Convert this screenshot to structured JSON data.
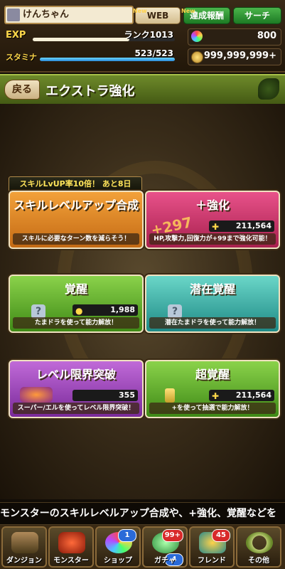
{
  "header": {
    "player_name": "けんちゃん",
    "web_label": "WEB",
    "report_label": "達成報酬",
    "search_label": "サーチ",
    "new_tag": "New",
    "exp_label": "EXP",
    "rank_text": "ランク1013",
    "exp_progress": 0.68,
    "stamina_label": "スタミナ",
    "stamina_text": "523/523",
    "stamina_progress": 1.0,
    "magic_stones": "800",
    "coins": "999,999,999+"
  },
  "titlebar": {
    "back_label": "戻る",
    "title": "エクストラ強化"
  },
  "cards": {
    "skill_banner": "スキルLvUP率10倍！ あと8日",
    "skill": {
      "title": "スキルレベルアップ合成",
      "sub": "スキルに必要なターン数を減らそう！"
    },
    "plus": {
      "title": "＋強化",
      "cost": "211,564",
      "art": "+297",
      "sub": "HP,攻撃力,回復力が+99まで強化可能！"
    },
    "awake": {
      "title": "覚醒",
      "cost": "1,988",
      "sub": "たまドラを使って能力解放！"
    },
    "latent": {
      "title": "潜在覚醒",
      "sub": "潜在たまドラを使って能力解放！"
    },
    "limit": {
      "title": "レベル限界突破",
      "cost": "355",
      "sub": "スーパー/エルを使ってレベル限界突破！"
    },
    "super": {
      "title": "超覚醒",
      "cost": "211,564",
      "sub": "+を使って抽選で能力解放！"
    }
  },
  "ticker": "モンスターのスキルレベルアップ合成や、+強化、覚醒などを",
  "nav": [
    {
      "label": "ダンジョン",
      "icon": "dungeon-gate-icon",
      "badge": ""
    },
    {
      "label": "モンスター",
      "icon": "dragon-icon",
      "badge": ""
    },
    {
      "label": "ショップ",
      "icon": "magic-stone-icon",
      "badge": "1"
    },
    {
      "label": "ガチャ",
      "icon": "egg-icon",
      "badge": "99+",
      "badge2": "4"
    },
    {
      "label": "フレンド",
      "icon": "friend-icon",
      "badge": "45"
    },
    {
      "label": "その他",
      "icon": "ring-icon",
      "badge": ""
    }
  ]
}
